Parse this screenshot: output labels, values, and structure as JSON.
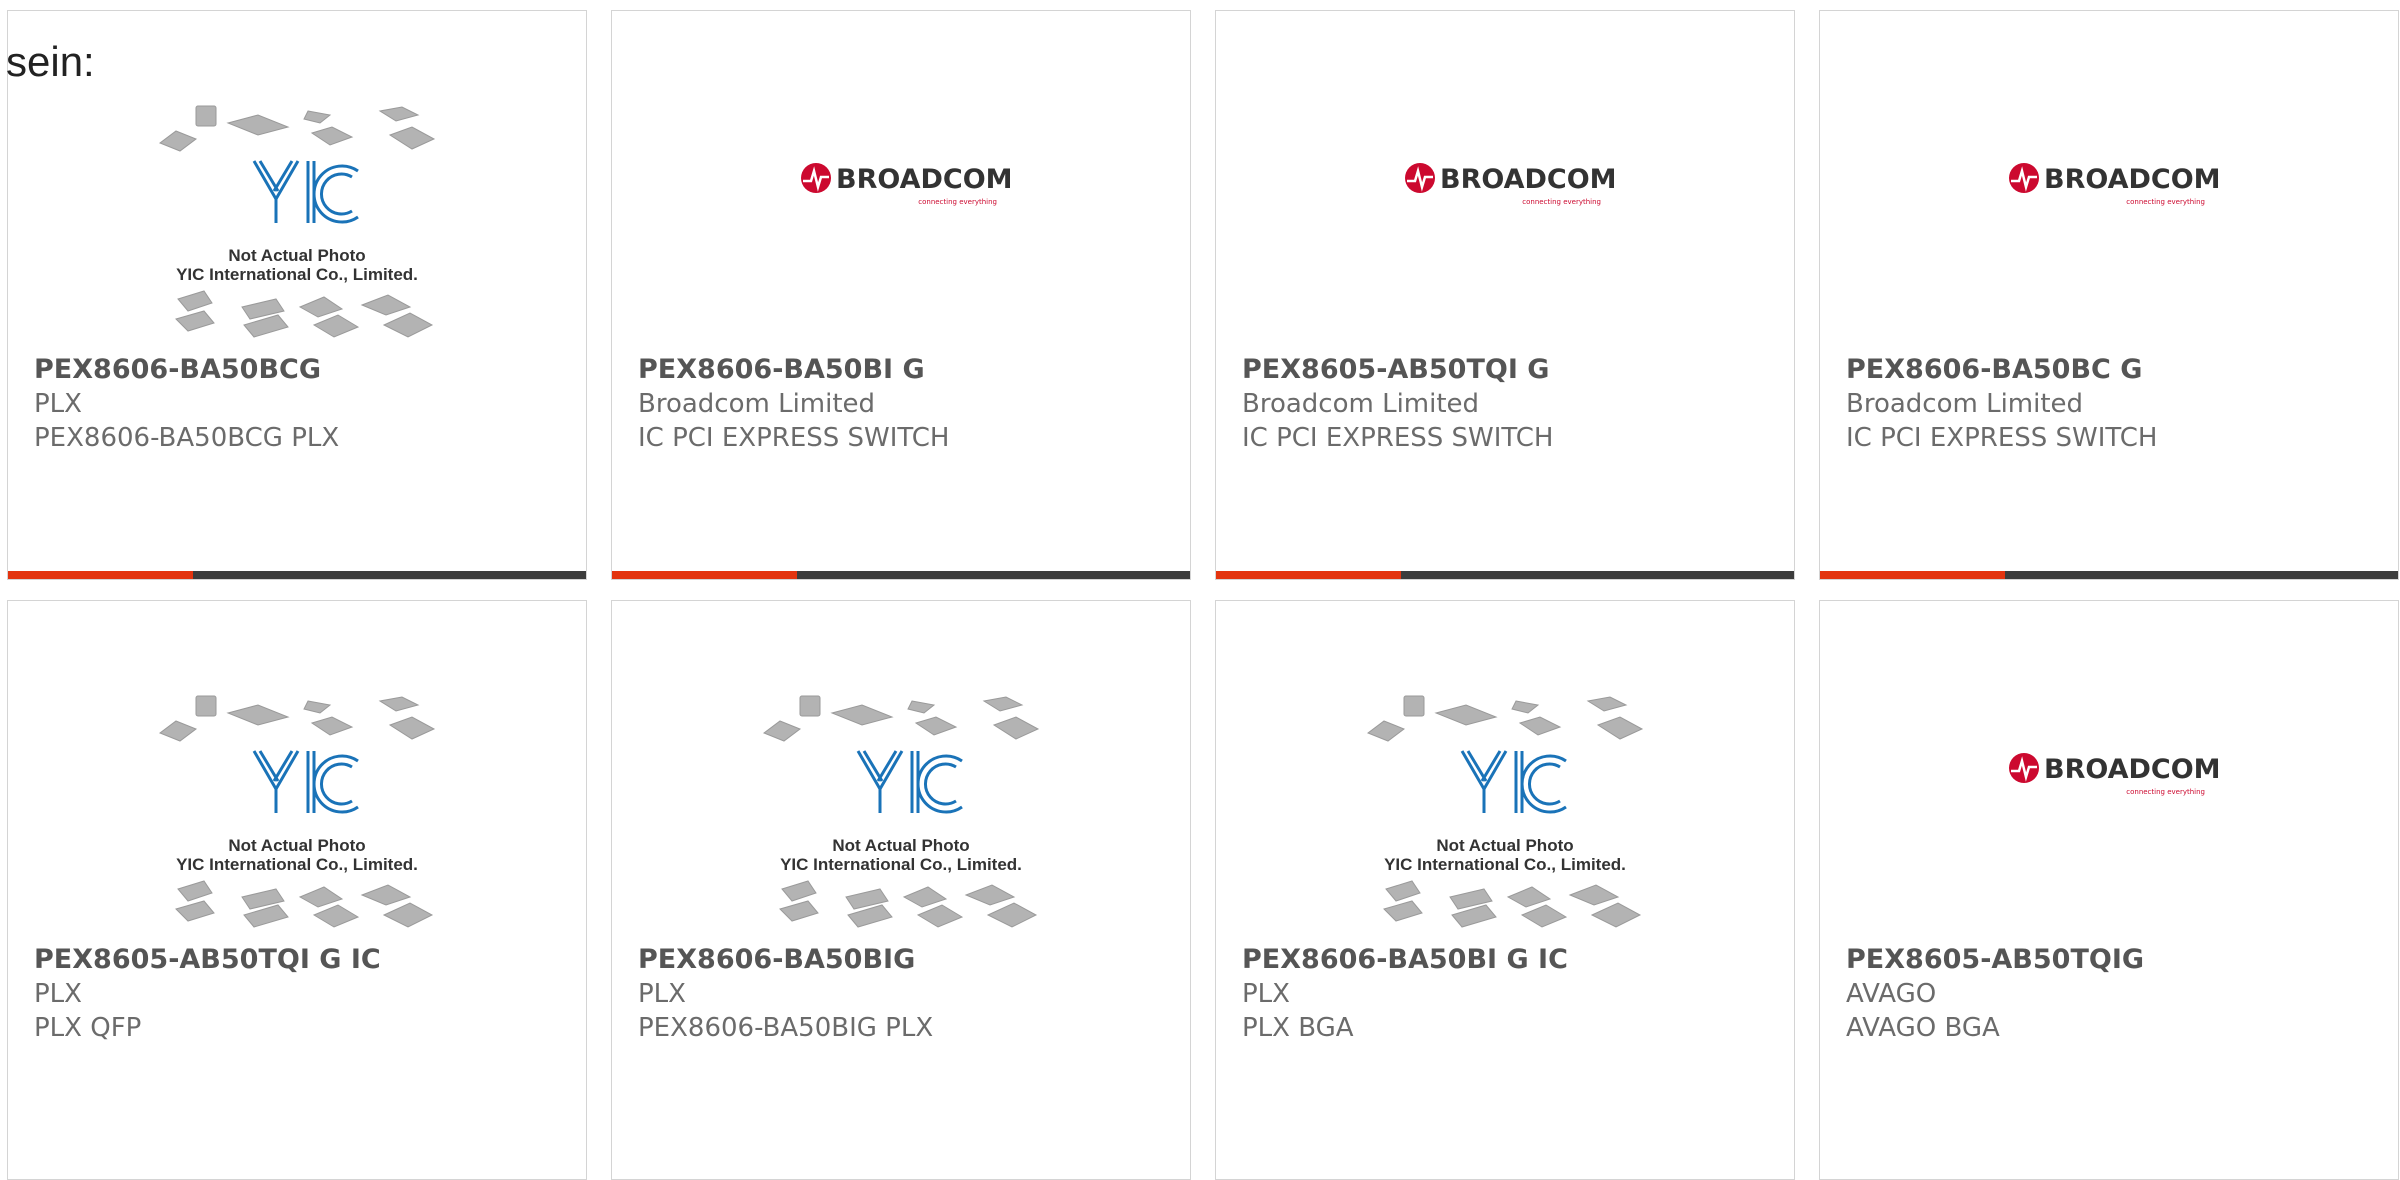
{
  "page": {
    "lead_text": "sein:"
  },
  "theme": {
    "accent": "#e3340f",
    "bar": "#3c3c3c",
    "broadcom_red": "#cc092f",
    "yic_blue": "#1a73b8"
  },
  "logos": {
    "yic": {
      "icon": "yic-placeholder-image",
      "line1": "Not Actual Photo",
      "line2": "YIC International Co., Limited."
    },
    "broadcom": {
      "icon": "broadcom-logo",
      "wordmark": "BROADCOM",
      "tagline": "connecting everything"
    }
  },
  "products": [
    {
      "part_number": "PEX8606-BA50BCG",
      "manufacturer": "PLX",
      "description": "PEX8606-BA50BCG PLX",
      "image": "yic",
      "accent_fraction": 0.32
    },
    {
      "part_number": "PEX8606-BA50BI G",
      "manufacturer": "Broadcom Limited",
      "description": "IC PCI EXPRESS SWITCH",
      "image": "broadcom",
      "accent_fraction": 0.32
    },
    {
      "part_number": "PEX8605-AB50TQI G",
      "manufacturer": "Broadcom Limited",
      "description": "IC PCI EXPRESS SWITCH",
      "image": "broadcom",
      "accent_fraction": 0.32
    },
    {
      "part_number": "PEX8606-BA50BC G",
      "manufacturer": "Broadcom Limited",
      "description": "IC PCI EXPRESS SWITCH",
      "image": "broadcom",
      "accent_fraction": 0.32
    },
    {
      "part_number": "PEX8605-AB50TQI G IC",
      "manufacturer": "PLX",
      "description": "PLX QFP",
      "image": "yic",
      "accent_fraction": 0
    },
    {
      "part_number": "PEX8606-BA50BIG",
      "manufacturer": "PLX",
      "description": "PEX8606-BA50BIG PLX",
      "image": "yic",
      "accent_fraction": 0
    },
    {
      "part_number": "PEX8606-BA50BI G IC",
      "manufacturer": "PLX",
      "description": "PLX BGA",
      "image": "yic",
      "accent_fraction": 0
    },
    {
      "part_number": "PEX8605-AB50TQIG",
      "manufacturer": "AVAGO",
      "description": "AVAGO BGA",
      "image": "broadcom",
      "accent_fraction": 0
    }
  ]
}
